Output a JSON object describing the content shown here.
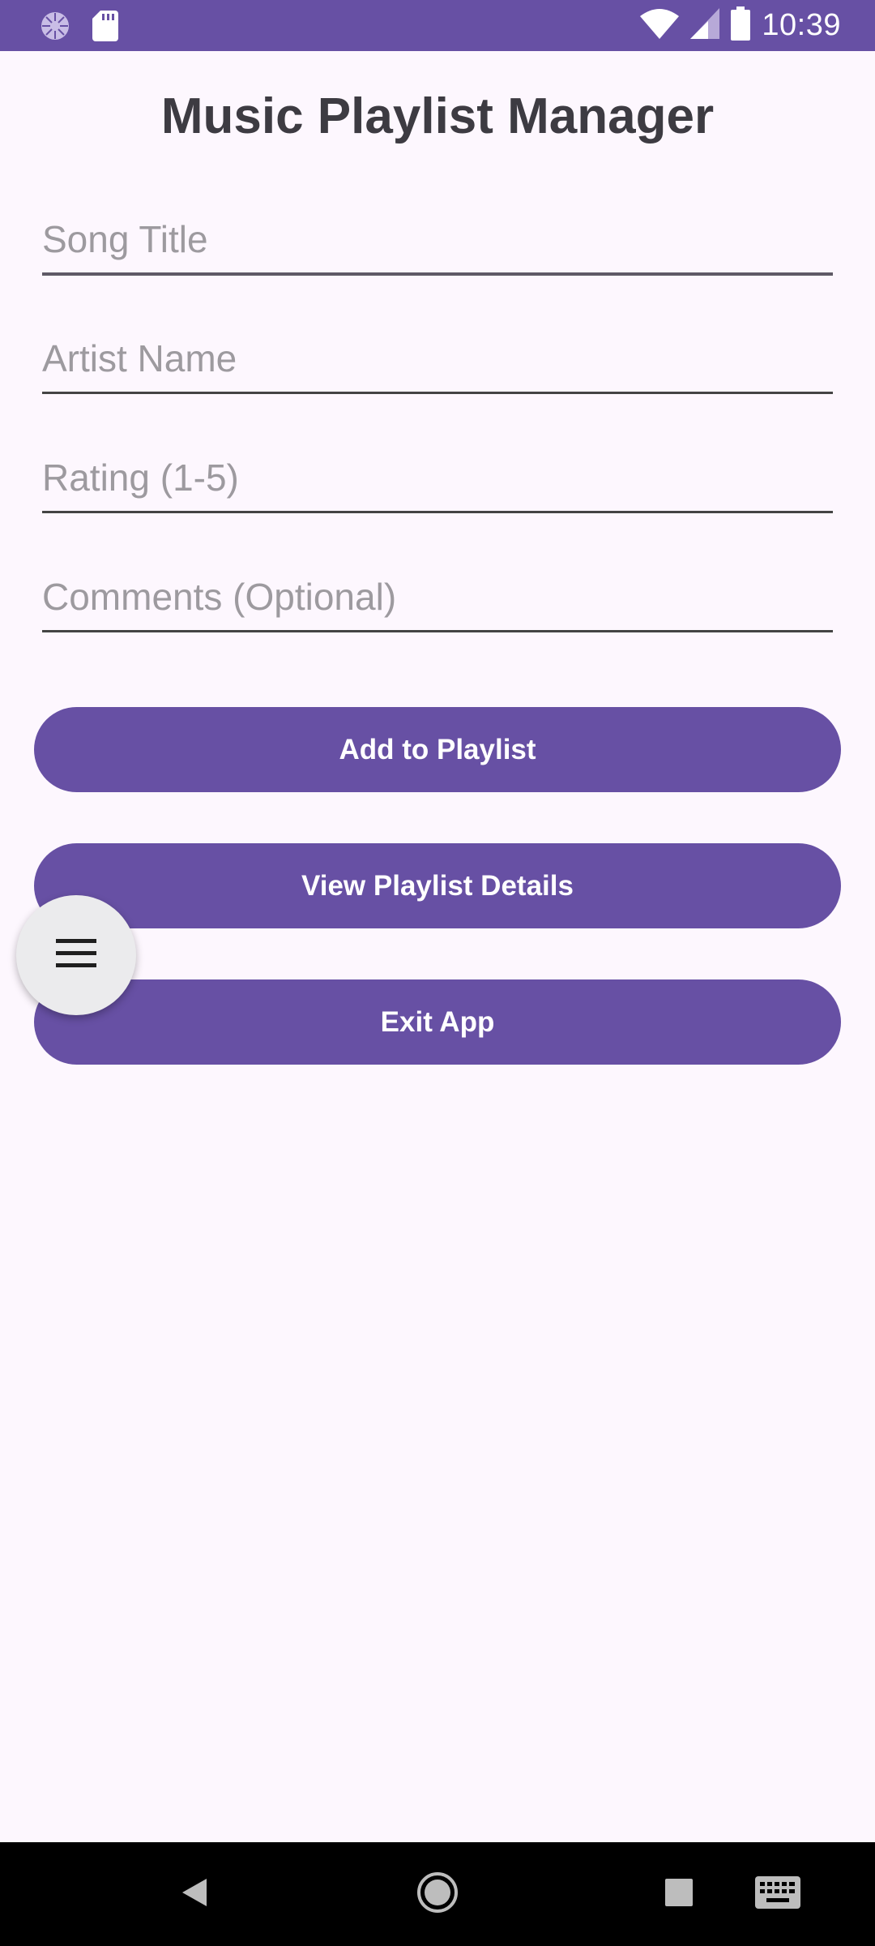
{
  "status_bar": {
    "time": "10:39",
    "icons": [
      "loading-indicator-icon",
      "sd-card-icon",
      "wifi-icon",
      "cell-signal-icon",
      "battery-icon"
    ]
  },
  "app": {
    "title": "Music Playlist Manager"
  },
  "form": {
    "song_title": {
      "value": "",
      "placeholder": "Song Title"
    },
    "artist_name": {
      "value": "",
      "placeholder": "Artist Name"
    },
    "rating": {
      "value": "",
      "placeholder": "Rating (1-5)"
    },
    "comments": {
      "value": "",
      "placeholder": "Comments (Optional)"
    }
  },
  "buttons": {
    "add": "Add to Playlist",
    "view": "View Playlist Details",
    "exit": "Exit App"
  },
  "fab": {
    "icon": "menu-icon"
  },
  "nav_bar": {
    "icons": [
      "back-icon",
      "home-icon",
      "recents-icon",
      "keyboard-icon"
    ]
  },
  "colors": {
    "accent": "#6750a4",
    "background": "#fdf7fe",
    "fab_background": "#ebebed",
    "title_text": "#3d3b42",
    "placeholder_text": "#9d9a9f"
  }
}
